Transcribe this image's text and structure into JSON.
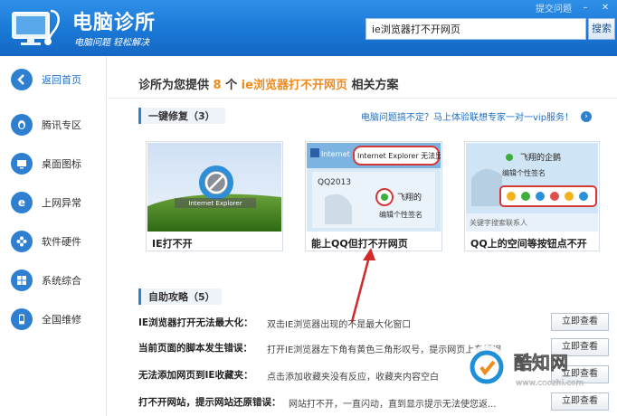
{
  "header": {
    "title": "电脑诊所",
    "slogan": "电脑问题 轻松解决",
    "feedback_link": "提交问题",
    "search_value": "ie浏览器打不开网页",
    "search_button": "搜索"
  },
  "sidebar": {
    "items": [
      {
        "label": "返回首页",
        "icon": "back-arrow-icon",
        "active": true
      },
      {
        "label": "腾讯专区",
        "icon": "penguin-icon"
      },
      {
        "label": "桌面图标",
        "icon": "monitor-icon"
      },
      {
        "label": "上网异常",
        "icon": "ie-icon"
      },
      {
        "label": "软件硬件",
        "icon": "puzzle-icon"
      },
      {
        "label": "系统综合",
        "icon": "windows-icon"
      },
      {
        "label": "全国维修",
        "icon": "phone-icon"
      }
    ]
  },
  "main": {
    "headline_pre": "诊所为您提供",
    "headline_count": "8",
    "headline_mid": "个",
    "headline_keyword": "ie浏览器打不开网页",
    "headline_post": "相关方案",
    "quick_fix_label": "一键修复（3）",
    "promo_text": "电脑问题搞不定？马上体验联想专家一对一vip服务！",
    "cards": [
      {
        "caption": "IE打不开",
        "thumb_text": "Internet Explorer"
      },
      {
        "caption": "能上QQ但打不开网页",
        "thumb_text": "Internet Explorer 无法显..."
      },
      {
        "caption": "QQ上的空间等按钮点不开",
        "thumb_text": "飞翔的企鹅"
      }
    ],
    "card2_qq": "QQ2013",
    "card2_name": "飞翔的",
    "card2_sign": "编辑个性签名",
    "card3_sign": "编辑个性签名",
    "card3_search": "关键字搜索联系人",
    "self_help_label": "自助攻略（5）",
    "guides": [
      {
        "title": "IE浏览器打开无法最大化：",
        "desc": "双击IE浏览器出现的不是最大化窗口",
        "button": "立即查看"
      },
      {
        "title": "当前页面的脚本发生错误：",
        "desc": "打开IE浏览器左下角有黄色三角形叹号，提示网页上有错误",
        "button": "立即查看"
      },
      {
        "title": "无法添加网页到IE收藏夹：",
        "desc": "点击添加收藏夹没有反应，收藏夹内容空白",
        "button": "立即查看"
      },
      {
        "title": "打不开网站，提示网站还原错误：",
        "desc": "网站打不开，一直闪动，直到显示提示无法使您返...",
        "button": "立即查看"
      }
    ]
  },
  "watermark": {
    "brand": "酷知网",
    "url": "www.coozhi.com"
  },
  "colors": {
    "header_blue": "#1a78d6",
    "accent_orange": "#f08a1c",
    "link_blue": "#1f6fc6"
  }
}
